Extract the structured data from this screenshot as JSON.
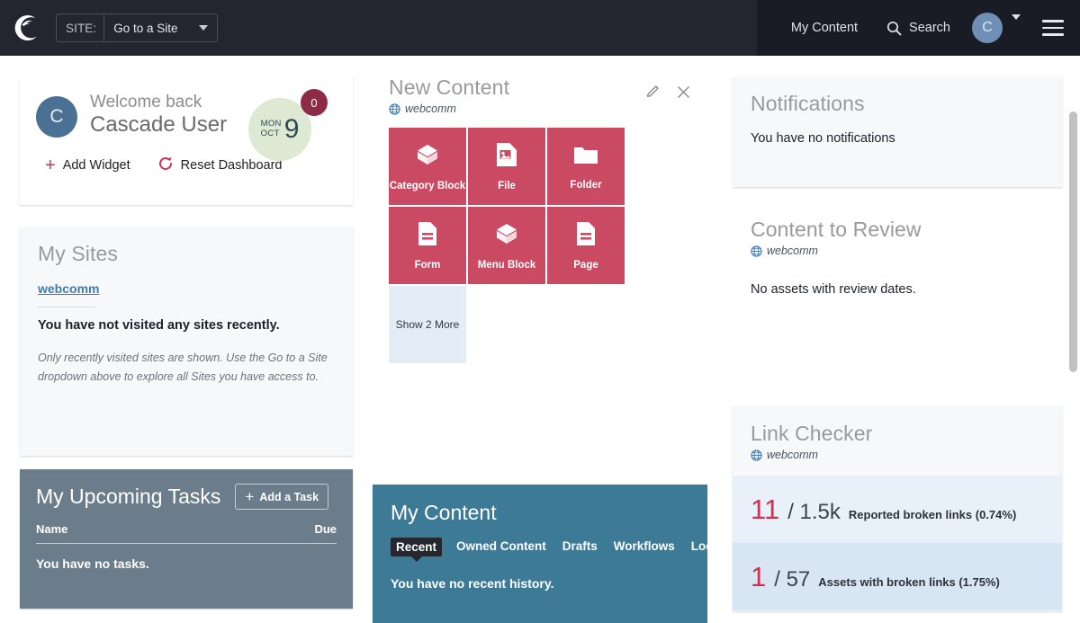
{
  "topbar": {
    "logo_icon": "cascade-moon-logo",
    "site_picker": {
      "label": "SITE:",
      "value": "Go to a Site",
      "caret_icon": "chevron-down-icon"
    },
    "my_content_label": "My Content",
    "search_label": "Search",
    "search_icon": "search-icon",
    "avatar_initial": "C",
    "avatar_caret_icon": "chevron-down-icon",
    "menu_icon": "hamburger-menu-icon",
    "bg_color": "#23262f",
    "right_bg_color": "#191c24"
  },
  "welcome": {
    "avatar_initial": "C",
    "greeting": "Welcome back",
    "user_name": "Cascade User",
    "date": {
      "weekday": "MON",
      "month": "OCT",
      "day": "9",
      "badge_count": "0",
      "circle_color": "#dde9d3",
      "badge_color": "#8d2a45"
    },
    "add_widget_label": "Add Widget",
    "add_widget_icon": "plus-icon",
    "reset_dashboard_label": "Reset Dashboard",
    "reset_dashboard_icon": "refresh-icon",
    "accent_color": "#d0314e"
  },
  "my_sites": {
    "title": "My Sites",
    "site_link": "webcomm",
    "message": "You have not visited any sites recently.",
    "note": "Only recently visited sites are shown. Use the Go to a Site dropdown above to explore all Sites you have access to."
  },
  "tasks": {
    "title": "My Upcoming Tasks",
    "add_task_label": "Add a Task",
    "add_task_icon": "plus-icon",
    "col_name": "Name",
    "col_due": "Due",
    "empty_message": "You have no tasks.",
    "bg_color": "#6b7d8a"
  },
  "new_content": {
    "title": "New Content",
    "site": "webcomm",
    "site_icon": "globe-icon",
    "edit_icon": "pencil-icon",
    "close_icon": "close-icon",
    "tile_color": "#ca4a63",
    "tiles": [
      {
        "label": "Category Block",
        "icon": "cube-icon"
      },
      {
        "label": "File",
        "icon": "image-file-icon"
      },
      {
        "label": "Folder",
        "icon": "folder-icon"
      },
      {
        "label": "Form",
        "icon": "document-icon"
      },
      {
        "label": "Menu Block",
        "icon": "cube-icon"
      },
      {
        "label": "Page",
        "icon": "document-icon"
      }
    ],
    "show_more_label": "Show 2 More"
  },
  "my_content": {
    "title": "My Content",
    "tabs": [
      {
        "label": "Recent",
        "active": true
      },
      {
        "label": "Owned Content",
        "active": false
      },
      {
        "label": "Drafts",
        "active": false
      },
      {
        "label": "Workflows",
        "active": false
      },
      {
        "label": "Locks",
        "active": false
      }
    ],
    "empty_message": "You have no recent history.",
    "bg_color": "#3d7a96"
  },
  "notifications": {
    "title": "Notifications",
    "message": "You have no notifications"
  },
  "content_to_review": {
    "title": "Content to Review",
    "site": "webcomm",
    "site_icon": "globe-icon",
    "message": "No assets with review dates."
  },
  "link_checker": {
    "title": "Link Checker",
    "site": "webcomm",
    "site_icon": "globe-icon",
    "rows": [
      {
        "count": "11",
        "total": "/ 1.5k",
        "description": "Reported broken links (0.74%)"
      },
      {
        "count": "1",
        "total": "/ 57",
        "description": "Assets with broken links (1.75%)"
      }
    ],
    "accent_color": "#d0314e"
  }
}
